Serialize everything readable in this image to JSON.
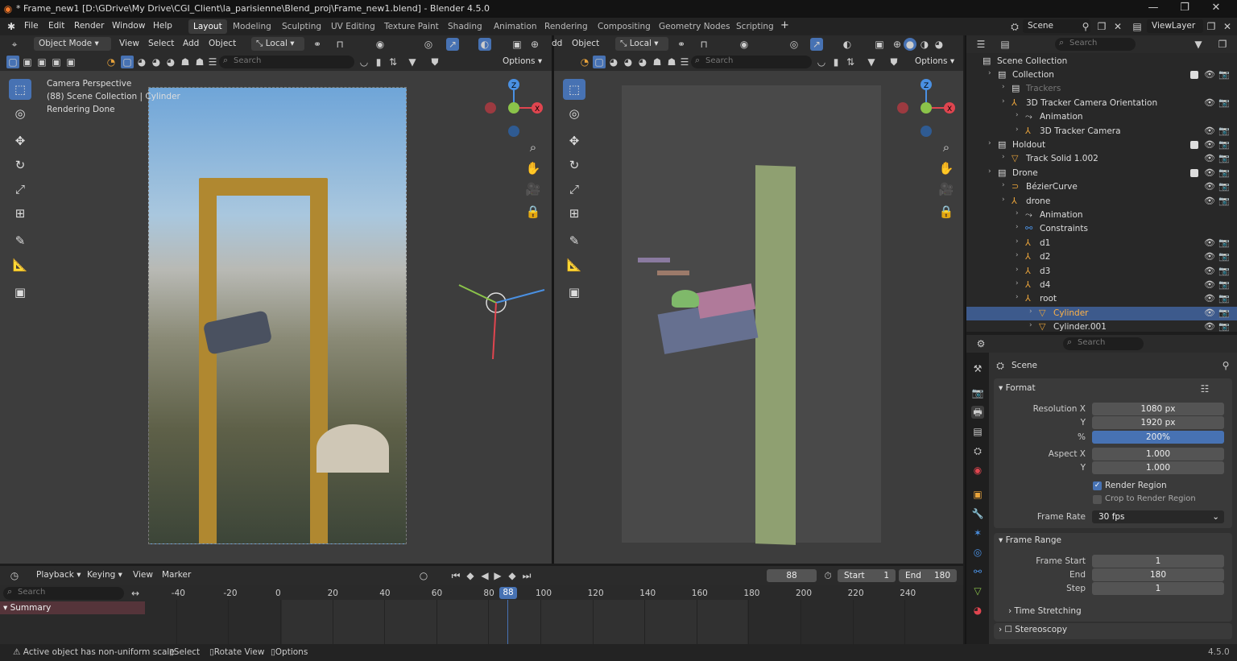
{
  "window": {
    "title": "* Frame_new1 [D:\\GDrive\\My Drive\\CGI_Client\\la_parisienne\\Blend_proj\\Frame_new1.blend] - Blender 4.5.0"
  },
  "menu": [
    "File",
    "Edit",
    "Render",
    "Window",
    "Help"
  ],
  "workspaces": [
    "Layout",
    "Modeling",
    "Sculpting",
    "UV Editing",
    "Texture Paint",
    "Shading",
    "Animation",
    "Rendering",
    "Compositing",
    "Geometry Nodes",
    "Scripting"
  ],
  "top_right": {
    "scene": "Scene",
    "view_layer": "ViewLayer"
  },
  "viewport_left": {
    "mode": "Object Mode",
    "menus": [
      "View",
      "Select",
      "Add",
      "Object"
    ],
    "transform": "Local",
    "search": "Search",
    "options": "Options",
    "overlay": [
      "Camera Perspective",
      "(88) Scene Collection | Cylinder",
      "Rendering Done"
    ]
  },
  "viewport_right": {
    "menus": [
      "dd",
      "Object"
    ],
    "transform": "Local",
    "search": "Search",
    "options": "Options"
  },
  "outliner": {
    "search": "Search",
    "root": "Scene Collection",
    "items": [
      {
        "label": "Collection",
        "indent": 1
      },
      {
        "label": "Trackers",
        "indent": 2,
        "dim": true
      },
      {
        "label": "3D Tracker Camera Orientation",
        "indent": 2
      },
      {
        "label": "Animation",
        "indent": 3
      },
      {
        "label": "3D Tracker Camera",
        "indent": 3
      },
      {
        "label": "Holdout",
        "indent": 1
      },
      {
        "label": "Track Solid 1.002",
        "indent": 2
      },
      {
        "label": "Drone",
        "indent": 1
      },
      {
        "label": "BézierCurve",
        "indent": 2
      },
      {
        "label": "drone",
        "indent": 2
      },
      {
        "label": "Animation",
        "indent": 3
      },
      {
        "label": "Constraints",
        "indent": 3
      },
      {
        "label": "d1",
        "indent": 3
      },
      {
        "label": "d2",
        "indent": 3
      },
      {
        "label": "d3",
        "indent": 3
      },
      {
        "label": "d4",
        "indent": 3
      },
      {
        "label": "root",
        "indent": 3
      },
      {
        "label": "Cylinder",
        "indent": 4,
        "selected": true
      },
      {
        "label": "Cylinder.001",
        "indent": 4
      }
    ]
  },
  "properties": {
    "search": "Search",
    "context": "Scene",
    "format": "Format",
    "res_x_label": "Resolution X",
    "res_x": "1080 px",
    "res_y_label": "Y",
    "res_y": "1920 px",
    "pct_label": "%",
    "pct": "200%",
    "aspect_x_label": "Aspect X",
    "aspect_x": "1.000",
    "aspect_y_label": "Y",
    "aspect_y": "1.000",
    "render_region": "Render Region",
    "crop": "Crop to Render Region",
    "frame_rate_label": "Frame Rate",
    "frame_rate": "30 fps",
    "frame_range": "Frame Range",
    "frame_start_label": "Frame Start",
    "frame_start": "1",
    "end_label": "End",
    "end": "180",
    "step_label": "Step",
    "step": "1",
    "time_stretching": "Time Stretching",
    "stereoscopy": "Stereoscopy"
  },
  "timeline": {
    "menus": [
      "Playback",
      "Keying",
      "View",
      "Marker"
    ],
    "current": "88",
    "start_label": "Start",
    "start": "1",
    "end_label": "End",
    "end": "180",
    "search": "Search",
    "summary": "Summary",
    "ticks": [
      "-40",
      "-20",
      "0",
      "20",
      "40",
      "60",
      "80",
      "100",
      "120",
      "140",
      "160",
      "180",
      "200",
      "220",
      "240"
    ]
  },
  "status": {
    "message": "Active object has non-uniform scale",
    "select": "Select",
    "rotate": "Rotate View",
    "options": "Options",
    "version": "4.5.0"
  },
  "colors": {
    "accent": "#4772b3",
    "x_axis": "#e0454f",
    "y_axis": "#8bc34a",
    "z_axis": "#4a90e2"
  }
}
